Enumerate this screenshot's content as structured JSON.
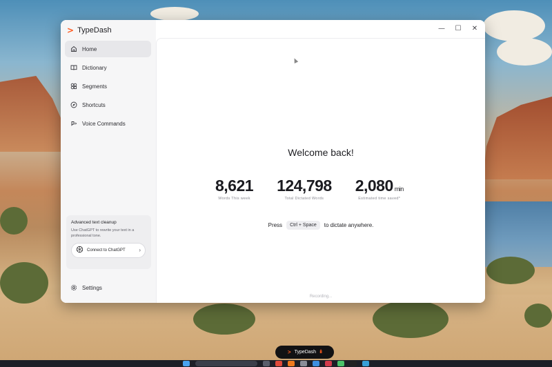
{
  "app": {
    "name": "TypeDash",
    "logo_glyph": ">",
    "accent_color": "#ff5a1f"
  },
  "window_controls": [
    {
      "name": "minimize",
      "glyph": "—"
    },
    {
      "name": "maximize",
      "glyph": "☐"
    },
    {
      "name": "close",
      "glyph": "✕"
    }
  ],
  "sidebar": {
    "items": [
      {
        "label": "Home",
        "icon": "home-icon",
        "active": true
      },
      {
        "label": "Dictionary",
        "icon": "book-icon",
        "active": false
      },
      {
        "label": "Segments",
        "icon": "segments-icon",
        "active": false
      },
      {
        "label": "Shortcuts",
        "icon": "compass-icon",
        "active": false
      },
      {
        "label": "Voice Commands",
        "icon": "voice-command-icon",
        "active": false
      }
    ],
    "promo": {
      "title": "Advanced text cleanup",
      "text": "Use ChatGPT to rewrite your text in a professional tone.",
      "button_label": "Connect to ChatGPT",
      "button_icon": "openai-icon"
    },
    "settings_label": "Settings"
  },
  "main": {
    "welcome": "Welcome back!",
    "stats": [
      {
        "value": "8,621",
        "unit": "",
        "label": "Words This week"
      },
      {
        "value": "124,798",
        "unit": "",
        "label": "Total Dictated Words"
      },
      {
        "value": "2,080",
        "unit": "min",
        "label": "Estimated time saved*"
      }
    ],
    "hint": {
      "prefix": "Press",
      "shortcut": "Ctrl + Space",
      "suffix": "to dictate anywhere."
    },
    "status": "Recording..."
  },
  "floating_pill": {
    "label": "TypeDash",
    "wave": "ıllı"
  }
}
